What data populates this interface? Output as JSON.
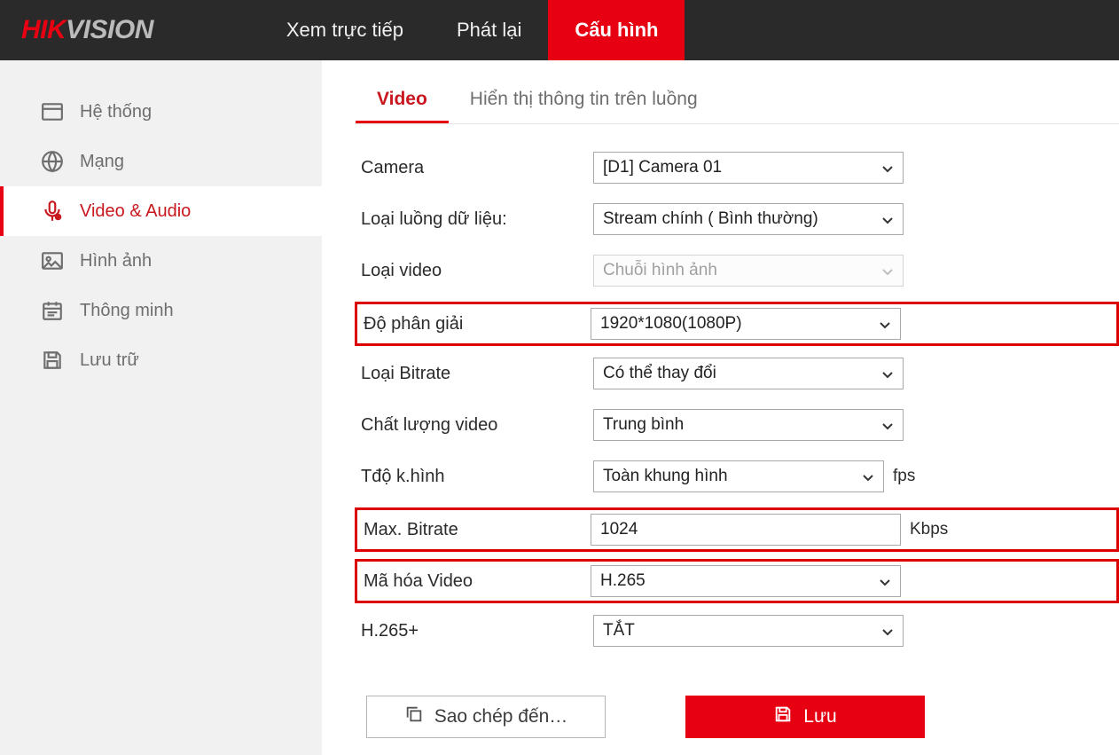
{
  "brand": {
    "hik": "HIK",
    "vision": "VISION"
  },
  "nav": {
    "live": "Xem trực tiếp",
    "playback": "Phát lại",
    "config": "Cấu hình"
  },
  "sidebar": {
    "system": "Hệ thống",
    "network": "Mạng",
    "videoaudio": "Video & Audio",
    "image": "Hình ảnh",
    "smart": "Thông minh",
    "storage": "Lưu trữ"
  },
  "tabs": {
    "video": "Video",
    "osd": "Hiển thị thông tin trên luồng"
  },
  "form": {
    "camera_lbl": "Camera",
    "camera_val": "[D1] Camera 01",
    "stream_lbl": "Loại luồng dữ liệu:",
    "stream_val": "Stream chính ( Bình thường)",
    "vidtype_lbl": "Loại video",
    "vidtype_val": "Chuỗi hình ảnh",
    "res_lbl": "Độ phân giải",
    "res_val": "1920*1080(1080P)",
    "bittype_lbl": "Loại Bitrate",
    "bittype_val": "Có thể thay đổi",
    "quality_lbl": "Chất lượng video",
    "quality_val": "Trung bình",
    "fps_lbl": "Tđộ k.hình",
    "fps_val": "Toàn khung hình",
    "fps_unit": "fps",
    "maxbit_lbl": "Max. Bitrate",
    "maxbit_val": "1024",
    "maxbit_unit": "Kbps",
    "enc_lbl": "Mã hóa Video",
    "enc_val": "H.265",
    "h265p_lbl": "H.265+",
    "h265p_val": "TẮT"
  },
  "buttons": {
    "copy": "Sao chép đến…",
    "save": "Lưu"
  },
  "colors": {
    "accent": "#e60012"
  }
}
